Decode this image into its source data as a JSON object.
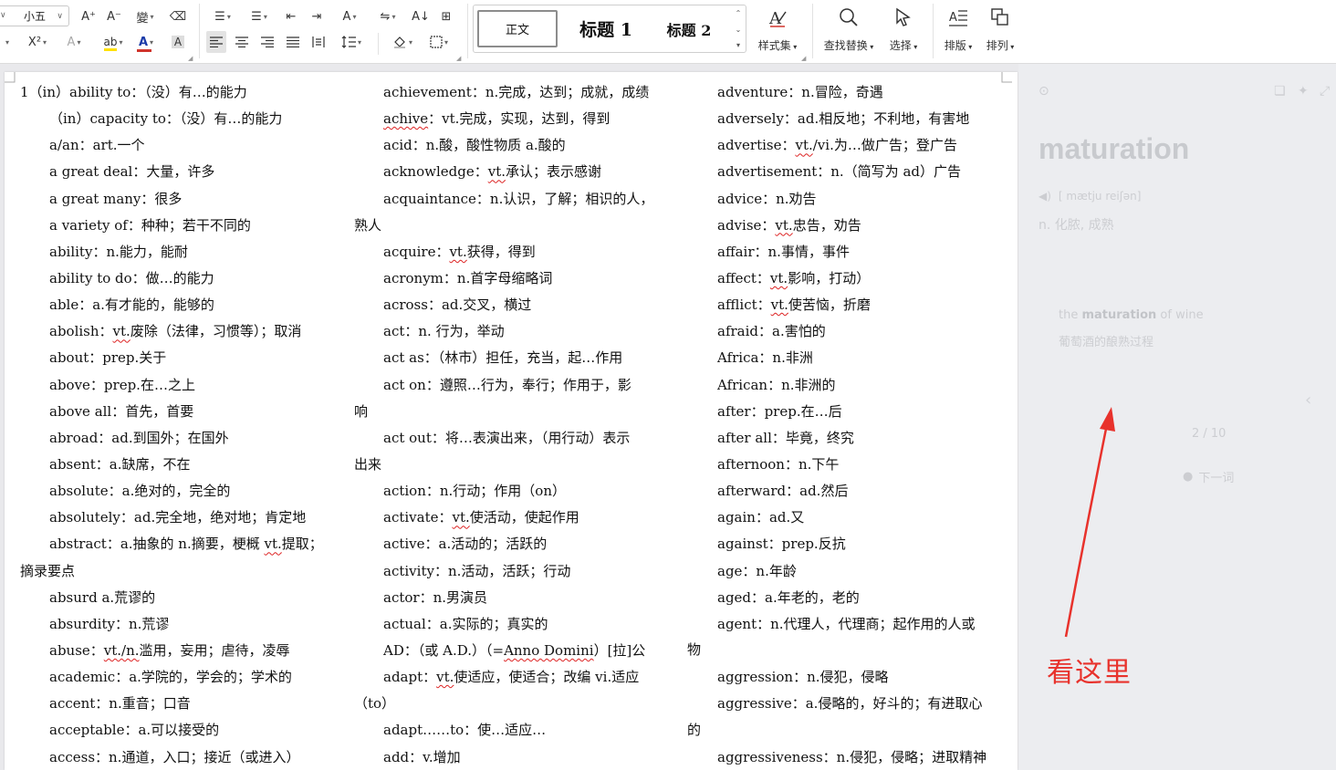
{
  "toolbar": {
    "font_size": "小五",
    "styles": {
      "normal": "正文",
      "heading1": "标题 1",
      "heading2": "标题 2"
    },
    "style_set": "样式集",
    "find_replace": "查找替换",
    "select": "选择",
    "layout": "排版",
    "arrange": "排列",
    "glyphs": {
      "grow": "A⁺",
      "shrink": "A⁻",
      "phonetic": "變",
      "clear": "⌫",
      "sup": "X²",
      "texteffect": "A",
      "highlight": "ab",
      "fontcolor": "A",
      "charshade": "A",
      "bullets": "☰",
      "numbering": "☰",
      "outdent": "⇤",
      "indent": "⇥",
      "pinyin": "A",
      "direction": "⇋",
      "sort": "A↓",
      "border": "⊞"
    },
    "accent_red": "#d0342c",
    "accent_yellow": "#ffe100"
  },
  "document": {
    "col1": [
      {
        "t": "1（in）ability to：（没）有…的能力",
        "noind": true
      },
      {
        "t": "（in）capacity to：（没）有…的能力"
      },
      {
        "t": "a/an：art.一个"
      },
      {
        "t": "a great deal：大量，许多"
      },
      {
        "t": "a great many：很多"
      },
      {
        "t": "a variety of：种种；若干不同的"
      },
      {
        "t": "ability：n.能力，能耐"
      },
      {
        "t": "ability to do：做…的能力"
      },
      {
        "t": "able：a.有才能的，能够的"
      },
      {
        "pre": "abolish：",
        "sq": "vt.",
        "post": "废除（法律，习惯等）；取消"
      },
      {
        "t": "about：prep.关于"
      },
      {
        "t": "above：prep.在…之上"
      },
      {
        "t": "above all：首先，首要"
      },
      {
        "t": "abroad：ad.到国外；在国外"
      },
      {
        "t": "absent：a.缺席，不在"
      },
      {
        "t": "absolute：a.绝对的，完全的"
      },
      {
        "t": "absolutely：ad.完全地，绝对地；肯定地"
      },
      {
        "pre": "abstract：a.抽象的 n.摘要，梗概 ",
        "sq": "vt.",
        "post": "提取；"
      },
      {
        "t": "摘录要点",
        "noind": true
      },
      {
        "t": "absurd a.荒谬的"
      },
      {
        "t": "absurdity：n.荒谬"
      },
      {
        "pre": "abuse：",
        "sq": "vt./n.",
        "post": "滥用，妄用；虐待，凌辱"
      },
      {
        "t": "academic：a.学院的，学会的；学术的"
      },
      {
        "t": "accent：n.重音；口音"
      },
      {
        "t": "acceptable：a.可以接受的"
      },
      {
        "t": "access：n.通道，入口；接近（或进入）"
      }
    ],
    "col2": [
      {
        "t": "achievement：n.完成，达到；成就，成绩"
      },
      {
        "pre": "",
        "sq": "achive",
        "post": "：vt.完成，实现，达到，得到"
      },
      {
        "t": "acid：n.酸，酸性物质 a.酸的"
      },
      {
        "pre": "acknowledge：",
        "sq": "vt.",
        "post": "承认；表示感谢"
      },
      {
        "t": "acquaintance：n.认识，了解；相识的人，"
      },
      {
        "t": "熟人",
        "noind": true
      },
      {
        "pre": "acquire：",
        "sq": "vt.",
        "post": "获得，得到"
      },
      {
        "t": "acronym：n.首字母缩略词"
      },
      {
        "t": "across：ad.交叉，横过"
      },
      {
        "t": "act：n. 行为，举动"
      },
      {
        "t": "act as：（林市）担任，充当，起…作用"
      },
      {
        "t": "act on：遵照…行为，奉行；作用于，影"
      },
      {
        "t": "响",
        "noind": true
      },
      {
        "t": "act out：将…表演出来，（用行动）表示"
      },
      {
        "t": "出来",
        "noind": true
      },
      {
        "t": "action：n.行动；作用（on）"
      },
      {
        "pre": "activate：",
        "sq": "vt.",
        "post": "使活动，使起作用"
      },
      {
        "t": "active：a.活动的；活跃的"
      },
      {
        "t": "activity：n.活动，活跃；行动"
      },
      {
        "t": "actor：n.男演员"
      },
      {
        "t": "actual：a.实际的；真实的"
      },
      {
        "pre": "AD：（或 A.D.）（=",
        "sq": "Anno Domini",
        "post": "）[拉]公"
      },
      {
        "pre": "adapt：",
        "sq": "vt.",
        "post": "使适应，使适合；改编 vi.适应"
      },
      {
        "t": "（to）",
        "noind": true
      },
      {
        "t": "adapt……to：使…适应…"
      },
      {
        "t": "add：v.增加"
      }
    ],
    "col2_overflow": {
      "r22": "物",
      "r25": "的"
    },
    "col3": [
      {
        "t": "adventure：n.冒险，奇遇"
      },
      {
        "t": "adversely：ad.相反地；不利地，有害地"
      },
      {
        "pre": "advertise：",
        "sq": "vt.",
        "post": "/vi.为…做广告；登广告"
      },
      {
        "t": "advertisement：n.（简写为 ad）广告"
      },
      {
        "t": "advice：n.劝告"
      },
      {
        "pre": "advise：",
        "sq": "vt.",
        "post": "忠告，劝告"
      },
      {
        "t": "affair：n.事情，事件"
      },
      {
        "pre": "affect：",
        "sq": "vt.",
        "post": "影响，打动）"
      },
      {
        "pre": "afflict：",
        "sq": "vt.",
        "post": "使苦恼，折磨"
      },
      {
        "t": "afraid：a.害怕的"
      },
      {
        "t": "Africa：n.非洲"
      },
      {
        "t": "African：n.非洲的"
      },
      {
        "t": "after：prep.在…后"
      },
      {
        "t": "after all：毕竟，终究"
      },
      {
        "t": "afternoon：n.下午"
      },
      {
        "t": "afterward：ad.然后"
      },
      {
        "t": "again：ad.又"
      },
      {
        "t": "against：prep.反抗"
      },
      {
        "t": "age：n.年龄"
      },
      {
        "t": "aged：a.年老的，老的"
      },
      {
        "t": "agent：n.代理人，代理商；起作用的人或"
      },
      {
        "t": "",
        "noind": true
      },
      {
        "t": "aggression：n.侵犯，侵略"
      },
      {
        "t": "aggressive：a.侵略的，好斗的；有进取心"
      },
      {
        "t": "",
        "noind": true
      },
      {
        "t": "aggressiveness：n.侵犯，侵略；进取精神"
      }
    ]
  },
  "panel": {
    "word": "maturation",
    "phonetic": "[ mætju reiʃən]",
    "meaning": "n. 化脓, 成熟",
    "example_pre": "the ",
    "example_word": "maturation",
    "example_post": " of wine",
    "example_cn": "葡萄酒的酿熟过程",
    "counter": "2 / 10",
    "next": "下一词"
  },
  "annotation": {
    "text": "看这里",
    "color": "#e8322c"
  }
}
